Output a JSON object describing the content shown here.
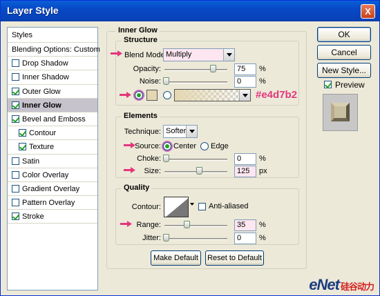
{
  "window": {
    "title": "Layer Style",
    "close_label": "X"
  },
  "styles_panel": {
    "header": "Styles",
    "items": [
      {
        "label": "Blending Options: Custom",
        "checkbox": false,
        "checked": false,
        "selected": false,
        "sub": false
      },
      {
        "label": "Drop Shadow",
        "checkbox": true,
        "checked": false,
        "selected": false,
        "sub": false
      },
      {
        "label": "Inner Shadow",
        "checkbox": true,
        "checked": false,
        "selected": false,
        "sub": false
      },
      {
        "label": "Outer Glow",
        "checkbox": true,
        "checked": true,
        "selected": false,
        "sub": false
      },
      {
        "label": "Inner Glow",
        "checkbox": true,
        "checked": true,
        "selected": true,
        "sub": false
      },
      {
        "label": "Bevel and Emboss",
        "checkbox": true,
        "checked": true,
        "selected": false,
        "sub": false
      },
      {
        "label": "Contour",
        "checkbox": true,
        "checked": true,
        "selected": false,
        "sub": true
      },
      {
        "label": "Texture",
        "checkbox": true,
        "checked": true,
        "selected": false,
        "sub": true
      },
      {
        "label": "Satin",
        "checkbox": true,
        "checked": false,
        "selected": false,
        "sub": false
      },
      {
        "label": "Color Overlay",
        "checkbox": true,
        "checked": false,
        "selected": false,
        "sub": false
      },
      {
        "label": "Gradient Overlay",
        "checkbox": true,
        "checked": false,
        "selected": false,
        "sub": false
      },
      {
        "label": "Pattern Overlay",
        "checkbox": true,
        "checked": false,
        "selected": false,
        "sub": false
      },
      {
        "label": "Stroke",
        "checkbox": true,
        "checked": true,
        "selected": false,
        "sub": false
      }
    ]
  },
  "inner_glow": {
    "title": "Inner Glow",
    "structure": {
      "title": "Structure",
      "blend_mode_label": "Blend Mode:",
      "blend_mode_value": "Multiply",
      "opacity_label": "Opacity:",
      "opacity_value": "75",
      "opacity_level": 0.75,
      "noise_label": "Noise:",
      "noise_value": "0",
      "noise_level": 0,
      "percent": "%",
      "glow_color": "#e4d7b2",
      "glow_color_note": "#e4d7b2"
    },
    "elements": {
      "title": "Elements",
      "technique_label": "Technique:",
      "technique_value": "Softer",
      "source_label": "Source:",
      "source_center": "Center",
      "source_edge": "Edge",
      "choke_label": "Choke:",
      "choke_value": "0",
      "choke_level": 0,
      "size_label": "Size:",
      "size_value": "125",
      "size_level": 0.5,
      "size_unit": "px"
    },
    "quality": {
      "title": "Quality",
      "contour_label": "Contour:",
      "anti_aliased_label": "Anti-aliased",
      "range_label": "Range:",
      "range_value": "35",
      "range_level": 0.35,
      "jitter_label": "Jitter:",
      "jitter_value": "0",
      "jitter_level": 0
    },
    "make_default": "Make Default",
    "reset_default": "Reset to Default"
  },
  "right_panel": {
    "ok": "OK",
    "cancel": "Cancel",
    "new_style": "New Style...",
    "preview_label": "Preview",
    "preview_checked": true
  },
  "watermark": {
    "brand": "eNet",
    "cn": "硅谷动力"
  },
  "colors": {
    "highlight_pink": "#e4367d",
    "glow": "#e4d7b2",
    "title_blue": "#0a5fd8"
  }
}
